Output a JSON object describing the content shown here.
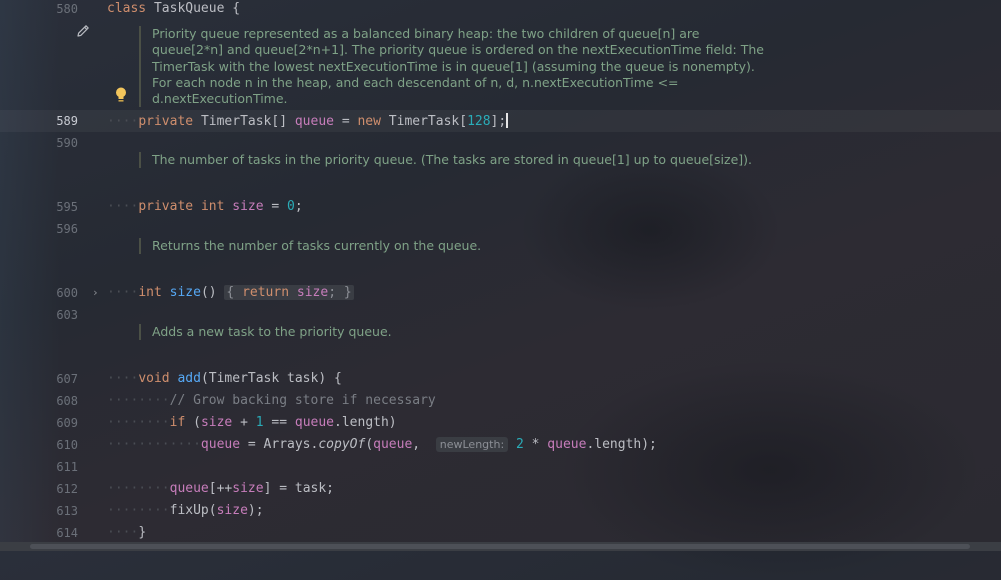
{
  "line_numbers": {
    "l580": "580",
    "l589": "589",
    "l590": "590",
    "l595": "595",
    "l596": "596",
    "l600": "600",
    "l603": "603",
    "l607": "607",
    "l608": "608",
    "l609": "609",
    "l610": "610",
    "l611": "611",
    "l612": "612",
    "l613": "613",
    "l614": "614"
  },
  "code": {
    "class_kw": "class",
    "class_name": "TaskQueue {",
    "private1": "private",
    "type1": "TimerTask[]",
    "queue_field": "queue",
    "eq": " = ",
    "new_kw": "new",
    "new_type": " TimerTask[",
    "n128": "128",
    "end1": "];",
    "private2": "private",
    "int_kw": "int",
    "size_field": "size",
    "zero": "0",
    "semi": ";",
    "int_kw2": "int",
    "size_fn": "size",
    "parens": "()",
    "fold_open": "{",
    "return_kw": "return",
    "size_ret": "size",
    "fold_close": "}",
    "void_kw": "void",
    "add_fn": "add",
    "add_params": "(TimerTask task) {",
    "comment_grow": "// Grow backing store if necessary",
    "if_kw": "if",
    "if_open": " (",
    "if_size": "size",
    "if_plus": " + ",
    "one": "1",
    "if_eqeq": " == ",
    "if_queue": "queue",
    "if_len": ".length)",
    "assign_queue": "queue",
    "assign_rest": " = Arrays.",
    "copyOf": "copyOf",
    "copy_open": "(",
    "copy_queue": "queue",
    "comma": ", ",
    "hint_newLength": "newLength:",
    "two": "2",
    "times": " * ",
    "copy_queue2": "queue",
    "copy_end": ".length);",
    "idx_queue": "queue",
    "idx_open": "[++",
    "idx_size": "size",
    "idx_close": "] = task;",
    "fixup": "fixUp(",
    "fixup_size": "size",
    "fixup_end": ");",
    "close_brace": "}"
  },
  "docs": {
    "heap": "Priority queue represented as a balanced binary heap: the two children of queue[n] are queue[2*n] and queue[2*n+1]. The priority queue is ordered on the nextExecutionTime field: The TimerTask with the lowest nextExecutionTime is in queue[1] (assuming the queue is nonempty). For each node n in the heap, and each descendant of n, d, n.nextExecutionTime <= d.nextExecutionTime.",
    "size": "The number of tasks in the priority queue. (The tasks are stored in queue[1] up to queue[size]).",
    "returns": "Returns the number of tasks currently on the queue.",
    "adds": "Adds a new task to the priority queue."
  },
  "icons": {
    "pencil": "pencil-icon",
    "bulb": "lightbulb-icon",
    "chevron": "chevron-right-icon"
  },
  "colors": {
    "keyword": "#cf8e6d",
    "field": "#c77dbb",
    "number": "#2aacb8",
    "function": "#56a8f5",
    "doc": "#7fa287",
    "bulb": "#f2c55c"
  }
}
